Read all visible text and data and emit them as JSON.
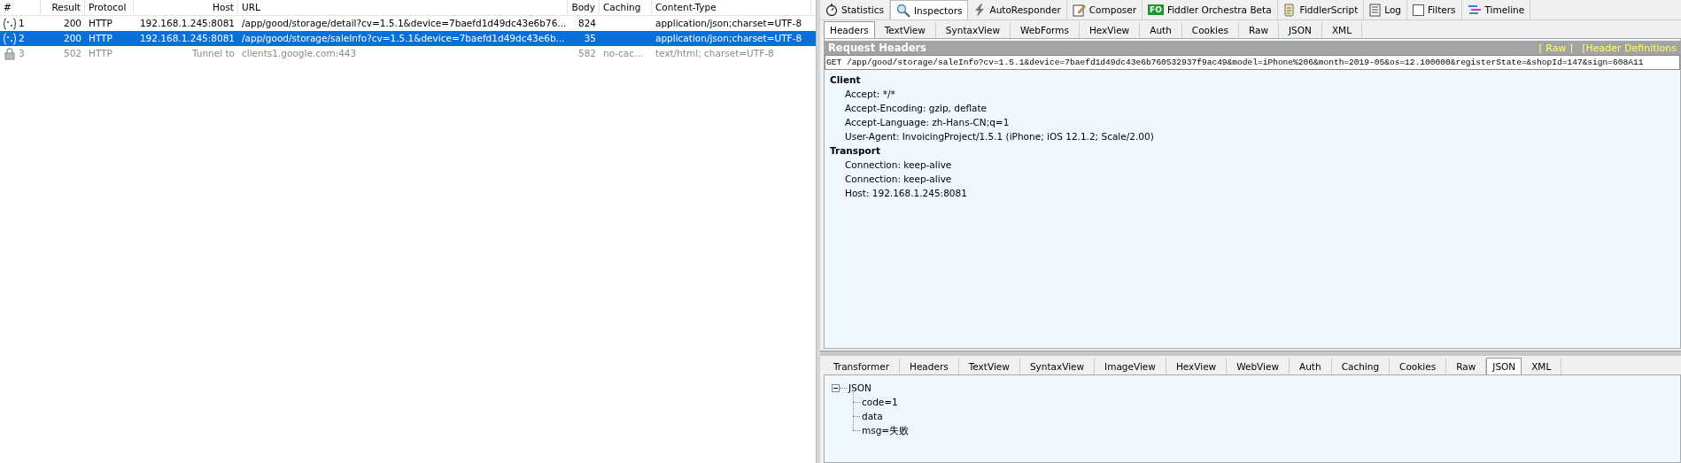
{
  "sessions": {
    "columns": [
      "#",
      "Result",
      "Protocol",
      "Host",
      "URL",
      "Body",
      "Caching",
      "Content-Type"
    ],
    "rows": [
      {
        "kind": "json",
        "selected": false,
        "muted": false,
        "cells": [
          "1",
          "200",
          "HTTP",
          "192.168.1.245:8081",
          "/app/good/storage/detail?cv=1.5.1&device=7baefd1d49dc43e6b76...",
          "824",
          "",
          "application/json;charset=UTF-8"
        ]
      },
      {
        "kind": "json",
        "selected": true,
        "muted": false,
        "cells": [
          "2",
          "200",
          "HTTP",
          "192.168.1.245:8081",
          "/app/good/storage/saleInfo?cv=1.5.1&device=7baefd1d49dc43e6b...",
          "35",
          "",
          "application/json;charset=UTF-8"
        ]
      },
      {
        "kind": "lock",
        "selected": false,
        "muted": true,
        "cells": [
          "3",
          "502",
          "HTTP",
          "Tunnel to",
          "clients1.google.com:443",
          "582",
          "no-cac...",
          "text/html; charset=UTF-8"
        ]
      }
    ]
  },
  "main_tabs": [
    {
      "label": "Statistics",
      "selected": false
    },
    {
      "label": "Inspectors",
      "selected": true
    },
    {
      "label": "AutoResponder",
      "selected": false
    },
    {
      "label": "Composer",
      "selected": false
    },
    {
      "label": "Fiddler Orchestra Beta",
      "selected": false,
      "badge": "FO"
    },
    {
      "label": "FiddlerScript",
      "selected": false
    },
    {
      "label": "Log",
      "selected": false
    },
    {
      "label": "Filters",
      "selected": false,
      "checked": false
    },
    {
      "label": "Timeline",
      "selected": false
    }
  ],
  "request_tabs": [
    {
      "label": "Headers",
      "selected": true
    },
    {
      "label": "TextView",
      "selected": false
    },
    {
      "label": "SyntaxView",
      "selected": false
    },
    {
      "label": "WebForms",
      "selected": false
    },
    {
      "label": "HexView",
      "selected": false
    },
    {
      "label": "Auth",
      "selected": false
    },
    {
      "label": "Cookies",
      "selected": false
    },
    {
      "label": "Raw",
      "selected": false
    },
    {
      "label": "JSON",
      "selected": false
    },
    {
      "label": "XML",
      "selected": false
    }
  ],
  "request_headers": {
    "title": "Request Headers",
    "links": [
      "[ Raw ]",
      "[Header Definitions"
    ],
    "request_line": "GET /app/good/storage/saleInfo?cv=1.5.1&device=7baefd1d49dc43e6b760532937f9ac49&model=iPhone%206&month=2019-05&os=12.100000&registerState=&shopId=147&sign=608A11",
    "groups": [
      {
        "name": "Client",
        "items": [
          "Accept: */*",
          "Accept-Encoding: gzip, deflate",
          "Accept-Language: zh-Hans-CN;q=1",
          "User-Agent: InvoicingProject/1.5.1 (iPhone; iOS 12.1.2; Scale/2.00)"
        ]
      },
      {
        "name": "Transport",
        "items": [
          "Connection: keep-alive",
          "Connection: keep-alive",
          "Host: 192.168.1.245:8081"
        ]
      }
    ]
  },
  "response_tabs": [
    {
      "label": "Transformer",
      "selected": false
    },
    {
      "label": "Headers",
      "selected": false
    },
    {
      "label": "TextView",
      "selected": false
    },
    {
      "label": "SyntaxView",
      "selected": false
    },
    {
      "label": "ImageView",
      "selected": false
    },
    {
      "label": "HexView",
      "selected": false
    },
    {
      "label": "WebView",
      "selected": false
    },
    {
      "label": "Auth",
      "selected": false
    },
    {
      "label": "Caching",
      "selected": false
    },
    {
      "label": "Cookies",
      "selected": false
    },
    {
      "label": "Raw",
      "selected": false
    },
    {
      "label": "JSON",
      "selected": true
    },
    {
      "label": "XML",
      "selected": false
    }
  ],
  "json_tree": {
    "label": "JSON",
    "expanded": true,
    "children": [
      {
        "label": "code=1"
      },
      {
        "label": "data"
      },
      {
        "label": "msg=失败"
      }
    ]
  }
}
